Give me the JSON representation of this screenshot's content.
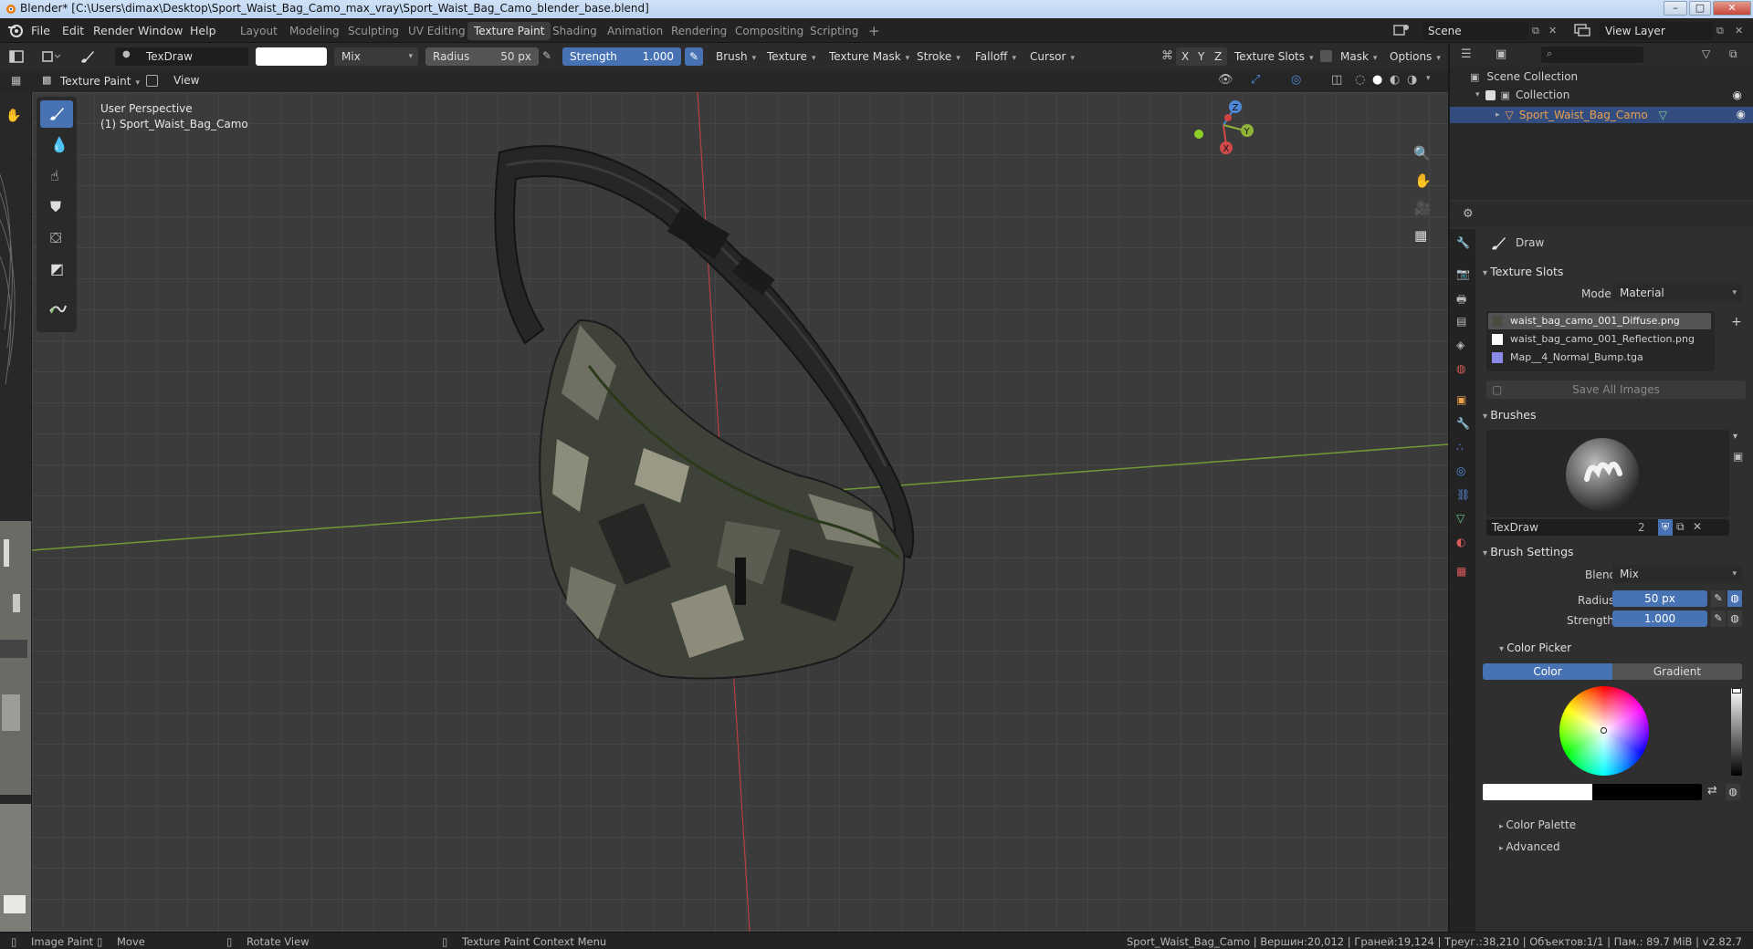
{
  "window": {
    "title": "Blender* [C:\\Users\\dimax\\Desktop\\Sport_Waist_Bag_Camo_max_vray\\Sport_Waist_Bag_Camo_blender_base.blend]"
  },
  "menu": {
    "items": [
      "File",
      "Edit",
      "Render",
      "Window",
      "Help"
    ]
  },
  "workspaces": [
    "Layout",
    "Modeling",
    "Sculpting",
    "UV Editing",
    "Texture Paint",
    "Shading",
    "Animation",
    "Rendering",
    "Compositing",
    "Scripting"
  ],
  "workspace_active": "Texture Paint",
  "scene": {
    "name": "Scene",
    "view_layer": "View Layer"
  },
  "tool_header": {
    "brush_name": "TexDraw",
    "blend": "Mix",
    "radius_label": "Radius",
    "radius_value": "50 px",
    "strength_label": "Strength",
    "strength_value": "1.000",
    "menus": [
      "Brush",
      "Texture",
      "Texture Mask",
      "Stroke",
      "Falloff",
      "Cursor"
    ],
    "axes": [
      "X",
      "Y",
      "Z"
    ],
    "texture_slots": "Texture Slots",
    "mask": "Mask",
    "options": "Options"
  },
  "viewport_header": {
    "mode": "Texture Paint",
    "view": "View"
  },
  "viewport": {
    "perspective": "User Perspective",
    "object": "(1) Sport_Waist_Bag_Camo"
  },
  "outliner": {
    "root": "Scene Collection",
    "collection": "Collection",
    "object": "Sport_Waist_Bag_Camo"
  },
  "properties": {
    "tool_name": "Draw",
    "texture_slots": {
      "title": "Texture Slots",
      "mode_label": "Mode",
      "mode_value": "Material",
      "items": [
        "waist_bag_camo_001_Diffuse.png",
        "waist_bag_camo_001_Reflection.png",
        "Map__4_Normal_Bump.tga"
      ],
      "save_all": "Save All Images"
    },
    "brushes": {
      "title": "Brushes",
      "name": "TexDraw",
      "users": "2"
    },
    "brush_settings": {
      "title": "Brush Settings",
      "blend_label": "Blend",
      "blend_value": "Mix",
      "radius_label": "Radius",
      "radius_value": "50 px",
      "strength_label": "Strength",
      "strength_value": "1.000"
    },
    "color_picker": {
      "title": "Color Picker",
      "tab_color": "Color",
      "tab_gradient": "Gradient"
    },
    "color_palette": "Color Palette",
    "advanced": "Advanced"
  },
  "statusbar": {
    "left": [
      "Image Paint",
      "Move",
      "Rotate View",
      "Texture Paint Context Menu"
    ],
    "right": "Sport_Waist_Bag_Camo | Вершин:20,012 | Граней:19,124 | Треуг.:38,210 | Объектов:1/1 | Пам.: 89.7 MiB | v2.82.7"
  },
  "colors": {
    "accent": "#4772b3",
    "selected_row": "#334d80",
    "x_axis": "#b84040",
    "y_axis": "#6f9a36"
  }
}
